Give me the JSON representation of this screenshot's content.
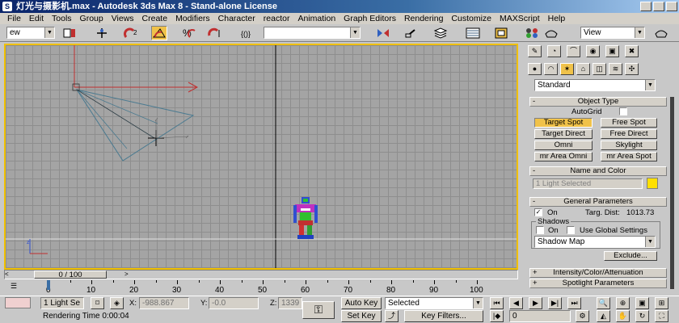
{
  "window": {
    "title": "灯光与摄影机.max - Autodesk 3ds Max 8 - Stand-alone License"
  },
  "menu": [
    "File",
    "Edit",
    "Tools",
    "Group",
    "Views",
    "Create",
    "Modifiers",
    "Character",
    "reactor",
    "Animation",
    "Graph Editors",
    "Rendering",
    "Customize",
    "MAXScript",
    "Help"
  ],
  "toolbar": {
    "selection_filter": "ew",
    "named_selection": "",
    "view_dropdown": "View"
  },
  "viewport": {
    "label": "",
    "accent_color": "#f0c000"
  },
  "command_panel": {
    "category_dropdown": "Standard",
    "object_type": {
      "header": "Object Type",
      "autogrid_label": "AutoGrid",
      "buttons": [
        "Target Spot",
        "Free Spot",
        "Target Direct",
        "Free Direct",
        "Omni",
        "Skylight",
        "mr Area Omni",
        "mr Area Spot"
      ]
    },
    "name_color": {
      "header": "Name and Color",
      "name_value": "1 Light Selected",
      "color": "#ffe000"
    },
    "general": {
      "header": "General Parameters",
      "on_label": "On",
      "targ_dist_label": "Targ. Dist:",
      "targ_dist_value": "1013.73",
      "shadows_label": "Shadows",
      "shadow_on_label": "On",
      "use_global_label": "Use Global Settings",
      "shadow_type": "Shadow Map",
      "exclude_label": "Exclude..."
    },
    "rollouts_collapsed": [
      "Intensity/Color/Attenuation",
      "Spotlight Parameters"
    ]
  },
  "timeline": {
    "slider_label": "0 / 100",
    "current_frame": 0,
    "total_frames": 100,
    "ticks": [
      "0",
      "10",
      "20",
      "30",
      "40",
      "50",
      "60",
      "70",
      "80",
      "90",
      "100"
    ]
  },
  "status": {
    "selection_count": "1 Light Se",
    "x_label": "X:",
    "x_value": "-988.867",
    "y_label": "Y:",
    "y_value": "-0.0",
    "z_label": "Z:",
    "z_value": "1339",
    "prompt": "Rendering Time  0:00:04",
    "auto_key": "Auto Key",
    "set_key": "Set Key",
    "key_mode": "Selected",
    "key_filters": "Key Filters...",
    "frame_field": "0"
  }
}
